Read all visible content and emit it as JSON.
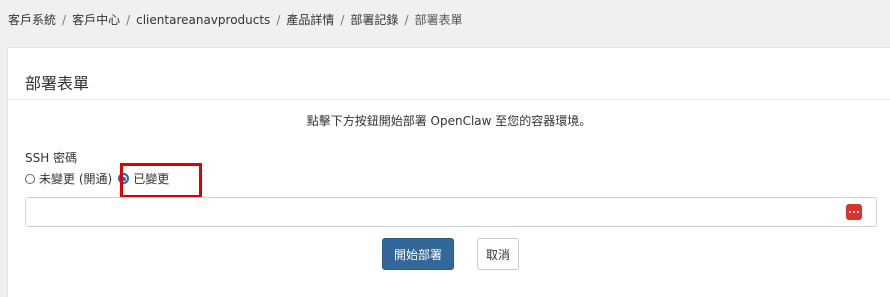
{
  "breadcrumb": [
    {
      "label": "客戶系統"
    },
    {
      "label": "客戶中心"
    },
    {
      "label": "clientareanavproducts"
    },
    {
      "label": "產品詳情"
    },
    {
      "label": "部署記錄"
    },
    {
      "label": "部署表單"
    }
  ],
  "separator": "/",
  "card": {
    "title": "部署表單",
    "instruction": "點擊下方按鈕開始部署 OpenClaw 至您的容器環境。",
    "ssh_password": {
      "label": "SSH 密碼",
      "options": [
        {
          "label": "未變更 (開通)",
          "checked": false
        },
        {
          "label": "已變更",
          "checked": true
        }
      ],
      "value": ""
    },
    "buttons": {
      "submit": "開始部署",
      "cancel": "取消"
    }
  },
  "colors": {
    "primary": "#336699",
    "highlight": "#e00000",
    "radio_checked": "#1a66c9",
    "pw_icon": "#d9342b"
  }
}
